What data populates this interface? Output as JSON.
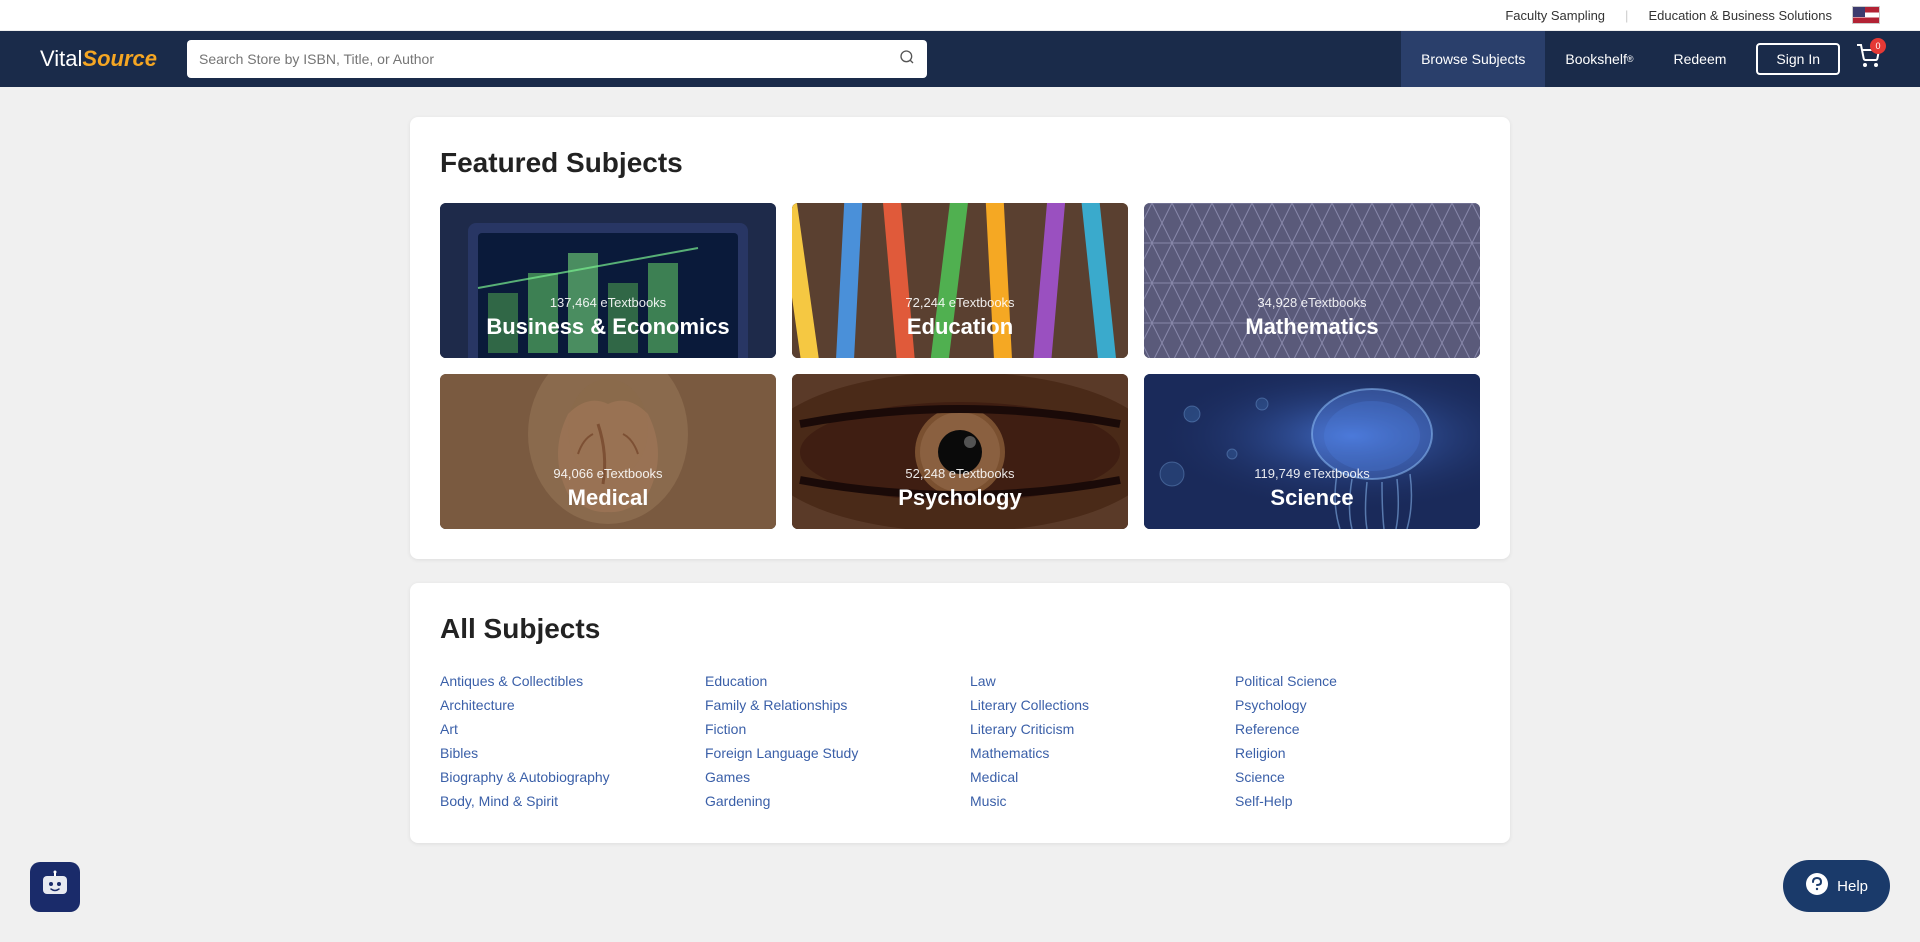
{
  "header": {
    "logo": {
      "vital": "Vital",
      "source": "Source"
    },
    "topLinks": [
      {
        "label": "Faculty Sampling"
      },
      {
        "label": "Education & Business Solutions"
      }
    ],
    "search": {
      "placeholder": "Search Store by ISBN, Title, or Author"
    },
    "navLinks": [
      {
        "label": "Browse Subjects",
        "active": true
      },
      {
        "label": "Bookshelf",
        "superscript": "®"
      },
      {
        "label": "Redeem"
      }
    ],
    "signIn": "Sign In",
    "cartBadge": "0"
  },
  "featured": {
    "sectionTitle": "Featured Subjects",
    "subjects": [
      {
        "count": "137,464 eTextbooks",
        "name": "Business & Economics",
        "bgClass": "bg-business"
      },
      {
        "count": "72,244 eTextbooks",
        "name": "Education",
        "bgClass": "bg-education"
      },
      {
        "count": "34,928 eTextbooks",
        "name": "Mathematics",
        "bgClass": "bg-mathematics"
      },
      {
        "count": "94,066 eTextbooks",
        "name": "Medical",
        "bgClass": "bg-medical"
      },
      {
        "count": "52,248 eTextbooks",
        "name": "Psychology",
        "bgClass": "bg-psychology"
      },
      {
        "count": "119,749 eTextbooks",
        "name": "Science",
        "bgClass": "bg-science"
      }
    ]
  },
  "allSubjects": {
    "sectionTitle": "All Subjects",
    "column1": [
      "Antiques & Collectibles",
      "Architecture",
      "Art",
      "Bibles",
      "Biography & Autobiography",
      "Body, Mind & Spirit"
    ],
    "column2": [
      "Education",
      "Family & Relationships",
      "Fiction",
      "Foreign Language Study",
      "Games",
      "Gardening"
    ],
    "column3": [
      "Law",
      "Literary Collections",
      "Literary Criticism",
      "Mathematics",
      "Medical",
      "Music"
    ],
    "column4": [
      "Political Science",
      "Psychology",
      "Reference",
      "Religion",
      "Science",
      "Self-Help"
    ]
  },
  "chatbot": {
    "icon": "😊"
  },
  "help": {
    "label": "Help",
    "icon": "💬"
  }
}
